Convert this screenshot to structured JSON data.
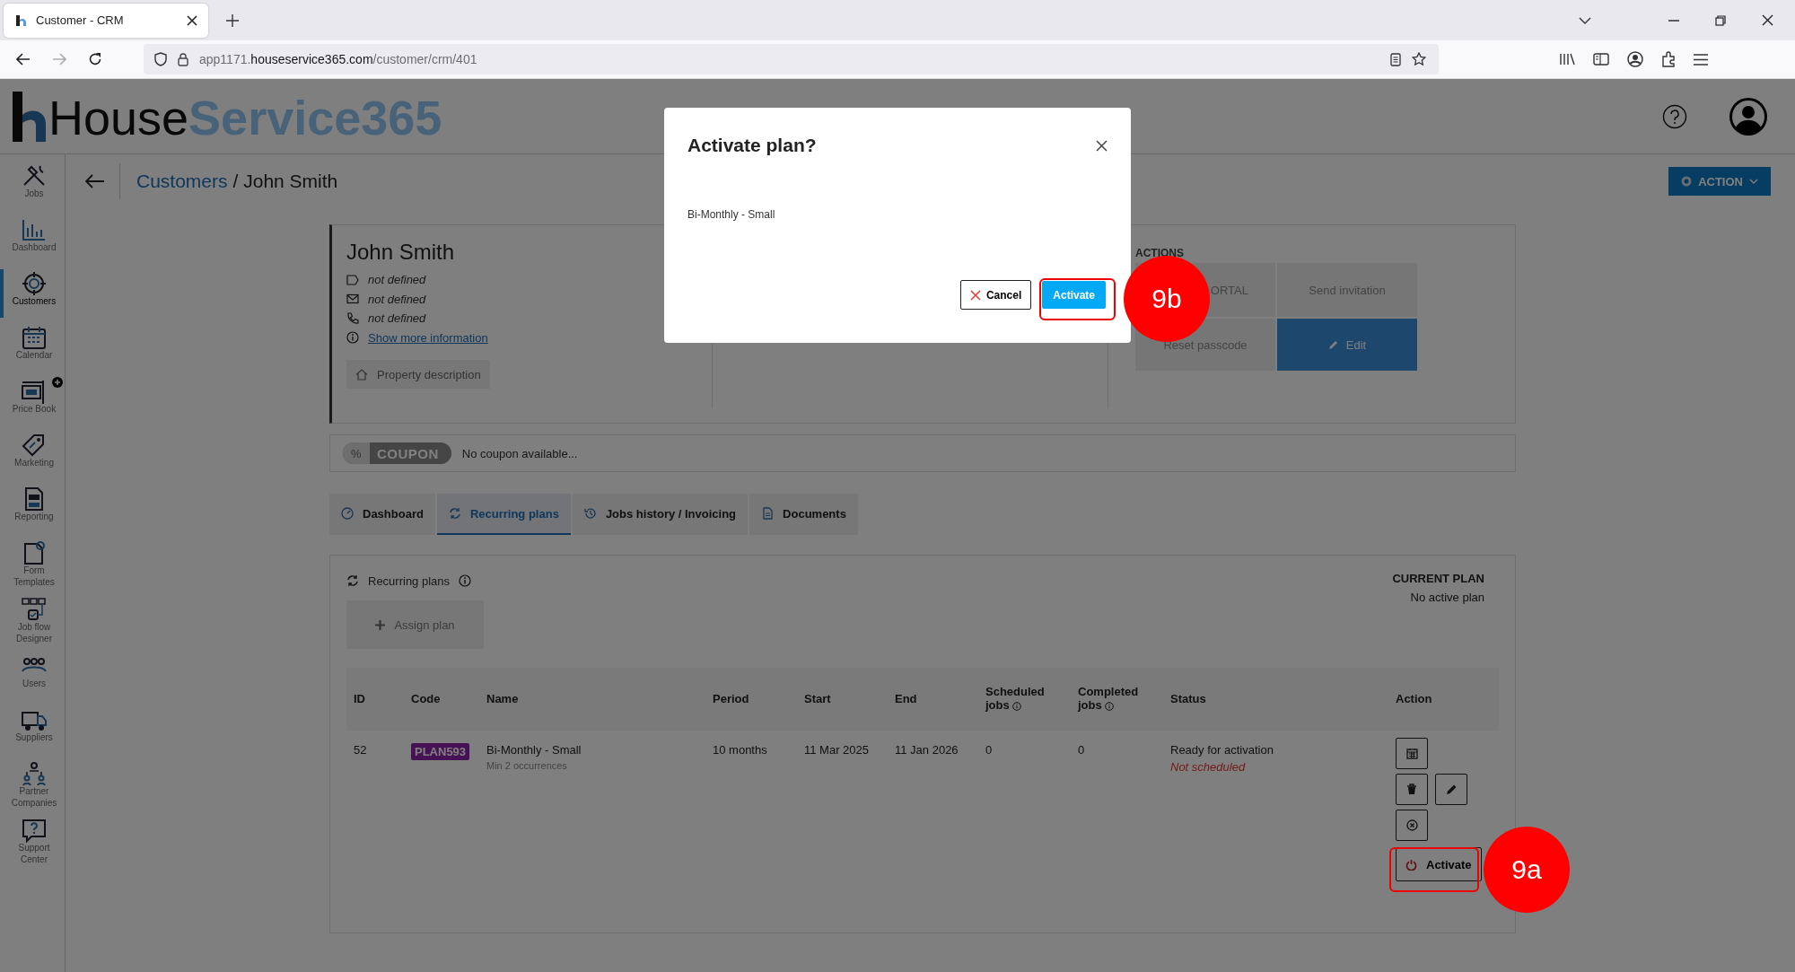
{
  "browser": {
    "tab_title": "Customer - CRM",
    "url_prefix": "app1171.",
    "url_domain": "houseservice365.com",
    "url_path": "/customer/crm/401"
  },
  "logo": {
    "dark": "House",
    "blue": "Service365"
  },
  "sidebar": {
    "items": [
      {
        "label": "Jobs",
        "selected": false
      },
      {
        "label": "Dashboard",
        "selected": false
      },
      {
        "label": "Customers",
        "selected": true
      },
      {
        "label": "Calendar",
        "selected": false
      },
      {
        "label": "Price Book",
        "selected": false
      },
      {
        "label": "Marketing",
        "selected": false
      },
      {
        "label": "Reporting",
        "selected": false
      },
      {
        "label": "Form Templates",
        "selected": false
      },
      {
        "label": "Job flow Designer",
        "selected": false
      },
      {
        "label": "Users",
        "selected": false
      },
      {
        "label": "Suppliers",
        "selected": false
      },
      {
        "label": "Partner Companies",
        "selected": false
      },
      {
        "label": "Support Center",
        "selected": false
      }
    ]
  },
  "breadcrumb": {
    "parent": "Customers",
    "separator": "/",
    "current": "John Smith"
  },
  "action_button": "ACTION",
  "customer": {
    "name": "John Smith",
    "details": [
      {
        "kind": "tag",
        "text": "not defined"
      },
      {
        "kind": "email",
        "text": "not defined"
      },
      {
        "kind": "phone",
        "text": "not defined"
      },
      {
        "kind": "link",
        "text": "Show more information"
      }
    ],
    "property_button": "Property description"
  },
  "actions": {
    "heading": "ACTIONS",
    "buttons": [
      {
        "label": "ORTAL",
        "kind": "plain"
      },
      {
        "label": "Send invitation",
        "kind": "plain"
      },
      {
        "label": "Reset passcode",
        "kind": "plain"
      },
      {
        "label": "Edit",
        "kind": "primary"
      }
    ]
  },
  "coupon": {
    "symbol": "%",
    "badge": "COUPON",
    "text": "No coupon available..."
  },
  "tabs": [
    {
      "label": "Dashboard",
      "selected": false
    },
    {
      "label": "Recurring plans",
      "selected": true
    },
    {
      "label": "Jobs history / Invoicing",
      "selected": false
    },
    {
      "label": "Documents",
      "selected": false
    }
  ],
  "plans": {
    "title": "Recurring plans",
    "assign_button": "Assign plan",
    "current_plan_heading": "CURRENT PLAN",
    "current_plan": "No active plan",
    "table": {
      "columns": [
        {
          "label": "ID",
          "info": false
        },
        {
          "label": "Code",
          "info": false
        },
        {
          "label": "Name",
          "info": false
        },
        {
          "label": "Period",
          "info": false
        },
        {
          "label": "Start",
          "info": false
        },
        {
          "label": "End",
          "info": false
        },
        {
          "label": "Scheduled jobs",
          "info": true
        },
        {
          "label": "Completed jobs",
          "info": true
        },
        {
          "label": "Status",
          "info": false
        },
        {
          "label": "Action",
          "info": false
        }
      ],
      "rows": [
        {
          "id": "52",
          "code": "PLAN593",
          "name": "Bi-Monthly - Small",
          "name_note": "Min 2 occurrences",
          "period": "10 months",
          "start": "11 Mar 2025",
          "end": "11 Jan 2026",
          "scheduled": "0",
          "completed": "0",
          "status": "Ready for activation",
          "status_note": "Not scheduled",
          "activate": "Activate"
        }
      ]
    }
  },
  "modal": {
    "title": "Activate plan?",
    "body": "Bi-Monthly - Small",
    "buttons": [
      {
        "label": "Cancel",
        "kind": "cancel"
      },
      {
        "label": "Activate",
        "kind": "primary"
      }
    ]
  },
  "annotations": [
    {
      "label": "9a"
    },
    {
      "label": "9b"
    }
  ]
}
